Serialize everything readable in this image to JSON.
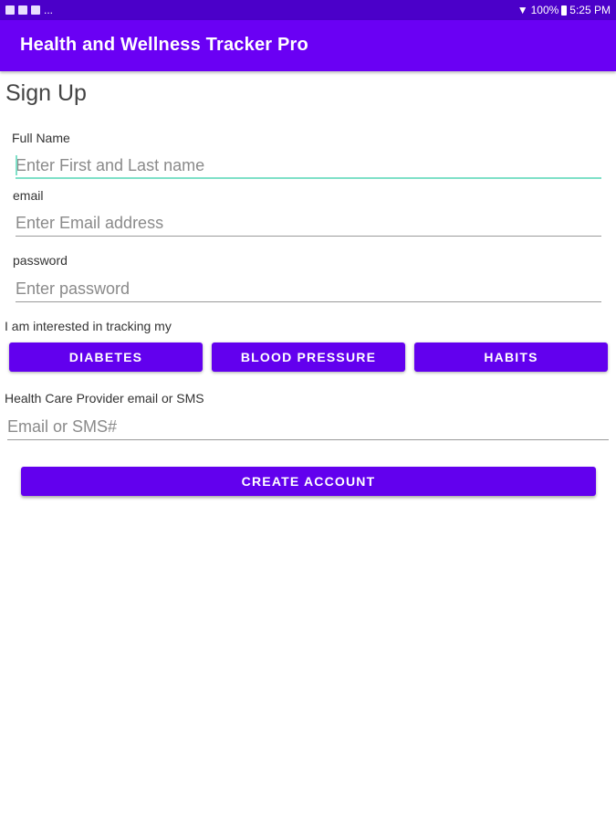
{
  "status_bar": {
    "left_icons": [
      "notification-icon",
      "facebook-icon",
      "message-icon"
    ],
    "overflow": "...",
    "battery": "100%",
    "time": "5:25 PM"
  },
  "app_bar": {
    "title": "Health and Wellness Tracker Pro"
  },
  "page": {
    "title": "Sign Up"
  },
  "form": {
    "full_name": {
      "label": "Full Name",
      "placeholder": "Enter First and Last name",
      "value": ""
    },
    "email": {
      "label": "email",
      "placeholder": "Enter Email address",
      "value": ""
    },
    "password": {
      "label": "password",
      "placeholder": "Enter password",
      "value": ""
    },
    "tracking_label": "I am interested in tracking my",
    "tracking_options": [
      "DIABETES",
      "BLOOD PRESSURE",
      "HABITS"
    ],
    "provider": {
      "label": "Health Care Provider email or SMS",
      "placeholder": "Email or SMS#",
      "value": ""
    },
    "submit_label": "CREATE ACCOUNT"
  },
  "colors": {
    "status_bar": "#4b00c9",
    "app_bar": "#6a00f4",
    "button": "#6200ee",
    "focus_underline": "#7fe0c8"
  }
}
